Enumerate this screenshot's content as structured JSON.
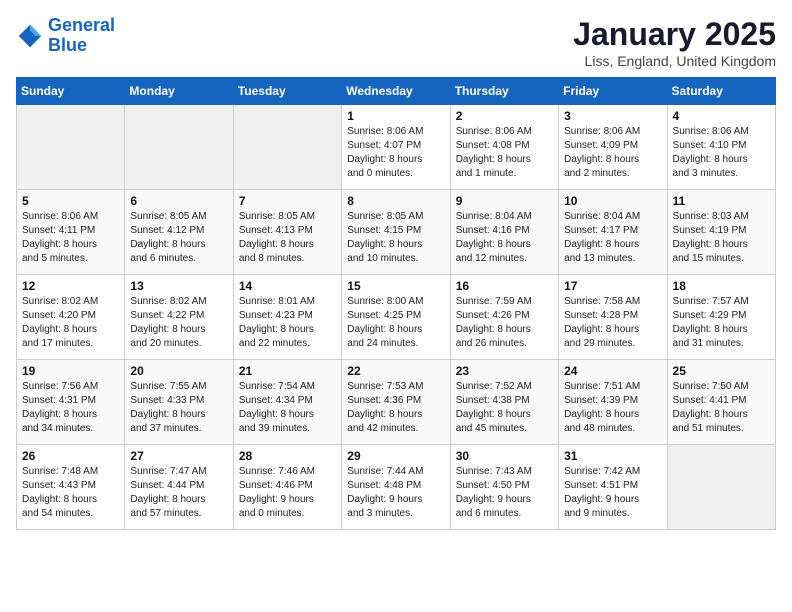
{
  "header": {
    "logo_line1": "General",
    "logo_line2": "Blue",
    "title": "January 2025",
    "subtitle": "Liss, England, United Kingdom"
  },
  "weekdays": [
    "Sunday",
    "Monday",
    "Tuesday",
    "Wednesday",
    "Thursday",
    "Friday",
    "Saturday"
  ],
  "weeks": [
    [
      {
        "day": "",
        "info": ""
      },
      {
        "day": "",
        "info": ""
      },
      {
        "day": "",
        "info": ""
      },
      {
        "day": "1",
        "info": "Sunrise: 8:06 AM\nSunset: 4:07 PM\nDaylight: 8 hours\nand 0 minutes."
      },
      {
        "day": "2",
        "info": "Sunrise: 8:06 AM\nSunset: 4:08 PM\nDaylight: 8 hours\nand 1 minute."
      },
      {
        "day": "3",
        "info": "Sunrise: 8:06 AM\nSunset: 4:09 PM\nDaylight: 8 hours\nand 2 minutes."
      },
      {
        "day": "4",
        "info": "Sunrise: 8:06 AM\nSunset: 4:10 PM\nDaylight: 8 hours\nand 3 minutes."
      }
    ],
    [
      {
        "day": "5",
        "info": "Sunrise: 8:06 AM\nSunset: 4:11 PM\nDaylight: 8 hours\nand 5 minutes."
      },
      {
        "day": "6",
        "info": "Sunrise: 8:05 AM\nSunset: 4:12 PM\nDaylight: 8 hours\nand 6 minutes."
      },
      {
        "day": "7",
        "info": "Sunrise: 8:05 AM\nSunset: 4:13 PM\nDaylight: 8 hours\nand 8 minutes."
      },
      {
        "day": "8",
        "info": "Sunrise: 8:05 AM\nSunset: 4:15 PM\nDaylight: 8 hours\nand 10 minutes."
      },
      {
        "day": "9",
        "info": "Sunrise: 8:04 AM\nSunset: 4:16 PM\nDaylight: 8 hours\nand 12 minutes."
      },
      {
        "day": "10",
        "info": "Sunrise: 8:04 AM\nSunset: 4:17 PM\nDaylight: 8 hours\nand 13 minutes."
      },
      {
        "day": "11",
        "info": "Sunrise: 8:03 AM\nSunset: 4:19 PM\nDaylight: 8 hours\nand 15 minutes."
      }
    ],
    [
      {
        "day": "12",
        "info": "Sunrise: 8:02 AM\nSunset: 4:20 PM\nDaylight: 8 hours\nand 17 minutes."
      },
      {
        "day": "13",
        "info": "Sunrise: 8:02 AM\nSunset: 4:22 PM\nDaylight: 8 hours\nand 20 minutes."
      },
      {
        "day": "14",
        "info": "Sunrise: 8:01 AM\nSunset: 4:23 PM\nDaylight: 8 hours\nand 22 minutes."
      },
      {
        "day": "15",
        "info": "Sunrise: 8:00 AM\nSunset: 4:25 PM\nDaylight: 8 hours\nand 24 minutes."
      },
      {
        "day": "16",
        "info": "Sunrise: 7:59 AM\nSunset: 4:26 PM\nDaylight: 8 hours\nand 26 minutes."
      },
      {
        "day": "17",
        "info": "Sunrise: 7:58 AM\nSunset: 4:28 PM\nDaylight: 8 hours\nand 29 minutes."
      },
      {
        "day": "18",
        "info": "Sunrise: 7:57 AM\nSunset: 4:29 PM\nDaylight: 8 hours\nand 31 minutes."
      }
    ],
    [
      {
        "day": "19",
        "info": "Sunrise: 7:56 AM\nSunset: 4:31 PM\nDaylight: 8 hours\nand 34 minutes."
      },
      {
        "day": "20",
        "info": "Sunrise: 7:55 AM\nSunset: 4:33 PM\nDaylight: 8 hours\nand 37 minutes."
      },
      {
        "day": "21",
        "info": "Sunrise: 7:54 AM\nSunset: 4:34 PM\nDaylight: 8 hours\nand 39 minutes."
      },
      {
        "day": "22",
        "info": "Sunrise: 7:53 AM\nSunset: 4:36 PM\nDaylight: 8 hours\nand 42 minutes."
      },
      {
        "day": "23",
        "info": "Sunrise: 7:52 AM\nSunset: 4:38 PM\nDaylight: 8 hours\nand 45 minutes."
      },
      {
        "day": "24",
        "info": "Sunrise: 7:51 AM\nSunset: 4:39 PM\nDaylight: 8 hours\nand 48 minutes."
      },
      {
        "day": "25",
        "info": "Sunrise: 7:50 AM\nSunset: 4:41 PM\nDaylight: 8 hours\nand 51 minutes."
      }
    ],
    [
      {
        "day": "26",
        "info": "Sunrise: 7:48 AM\nSunset: 4:43 PM\nDaylight: 8 hours\nand 54 minutes."
      },
      {
        "day": "27",
        "info": "Sunrise: 7:47 AM\nSunset: 4:44 PM\nDaylight: 8 hours\nand 57 minutes."
      },
      {
        "day": "28",
        "info": "Sunrise: 7:46 AM\nSunset: 4:46 PM\nDaylight: 9 hours\nand 0 minutes."
      },
      {
        "day": "29",
        "info": "Sunrise: 7:44 AM\nSunset: 4:48 PM\nDaylight: 9 hours\nand 3 minutes."
      },
      {
        "day": "30",
        "info": "Sunrise: 7:43 AM\nSunset: 4:50 PM\nDaylight: 9 hours\nand 6 minutes."
      },
      {
        "day": "31",
        "info": "Sunrise: 7:42 AM\nSunset: 4:51 PM\nDaylight: 9 hours\nand 9 minutes."
      },
      {
        "day": "",
        "info": ""
      }
    ]
  ]
}
